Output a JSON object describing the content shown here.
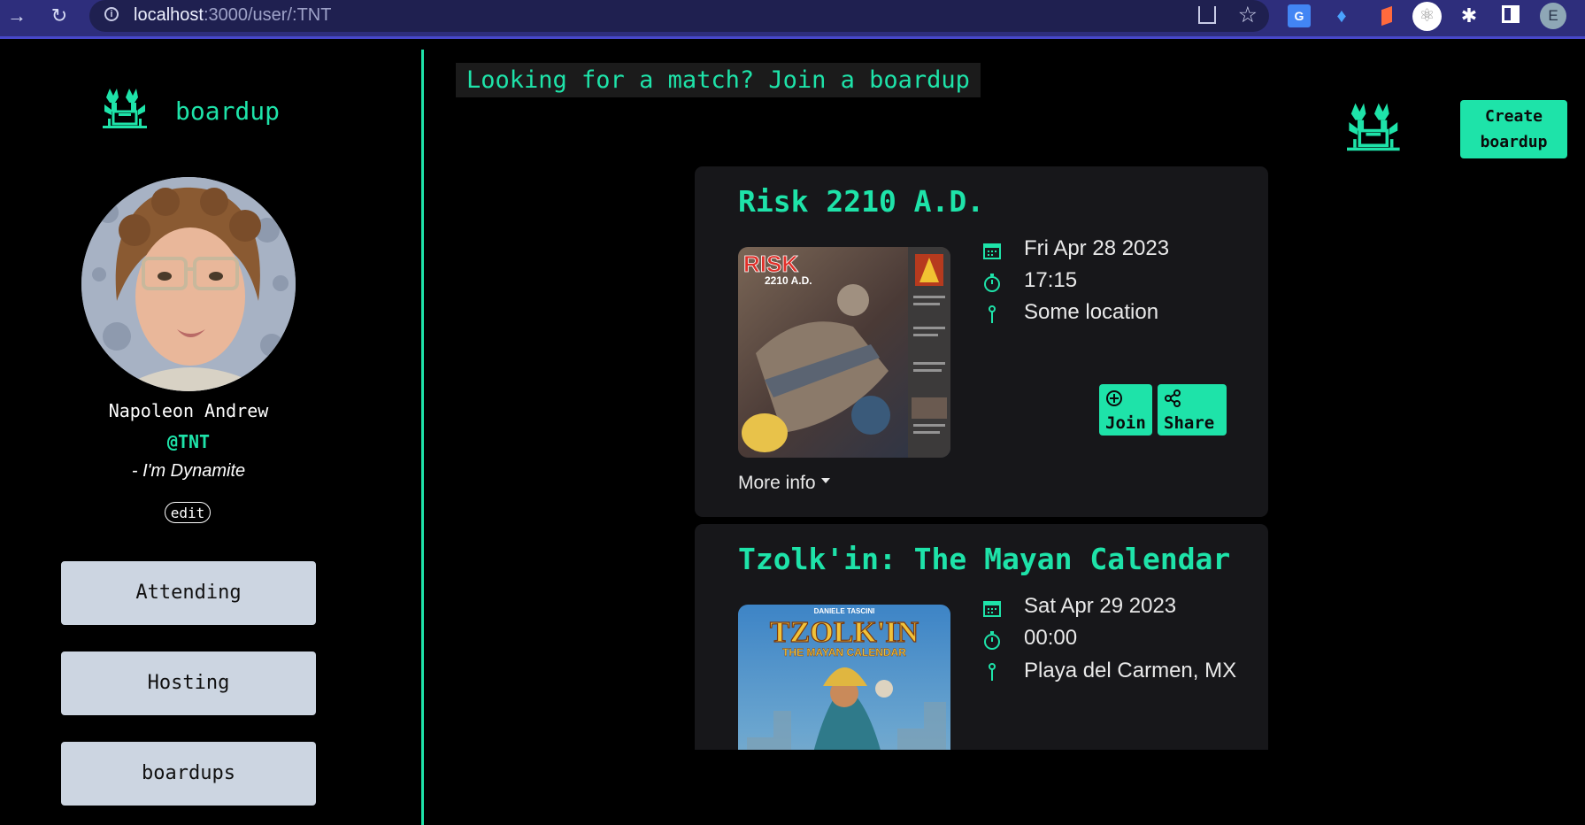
{
  "browser": {
    "url_host": "localhost",
    "url_path": ":3000/user/:TNT",
    "profile_initial": "E",
    "translate_label": "G"
  },
  "sidebar": {
    "brand": "boardup",
    "user": {
      "name": "Napoleon Andrew",
      "handle": "@TNT",
      "bio": "- I'm Dynamite",
      "edit_label": "edit"
    },
    "nav": [
      {
        "label": "Attending"
      },
      {
        "label": "Hosting"
      },
      {
        "label": "boardups"
      }
    ]
  },
  "main": {
    "cta": "Looking for a match? Join a boardup",
    "create_button": "Create boardup",
    "create_line1": "Create",
    "create_line2": "boardup",
    "events": [
      {
        "title": "Risk 2210 A.D.",
        "cover_title": "RISK",
        "cover_subtitle": "2210 A.D.",
        "date": "Fri Apr 28 2023",
        "time": "17:15",
        "location": "Some location",
        "join_label": "Join",
        "share_label": "Share",
        "more_info": "More info"
      },
      {
        "title": "Tzolk'in: The Mayan Calendar",
        "cover_title": "TZOLK'IN",
        "cover_subtitle": "THE MAYAN CALENDAR",
        "cover_author": "DANIELE TASCINI",
        "date": "Sat Apr 29 2023",
        "time": "00:00",
        "location": "Playa del Carmen, MX"
      }
    ]
  },
  "colors": {
    "accent": "#1ee3a9",
    "background": "#000000",
    "card": "#17171a",
    "sidebar_button": "#ccd5e1",
    "browser_chrome": "#2e2e7c"
  },
  "icons": [
    "arrow-right-icon",
    "reload-icon",
    "info-icon",
    "share-page-icon",
    "star-icon",
    "translate-icon",
    "gem-icon",
    "flag-icon",
    "react-icon",
    "puzzle-icon",
    "side-panel-icon",
    "boardup-logo",
    "calendar-icon",
    "stopwatch-icon",
    "pin-icon",
    "plus-circle-icon",
    "share-icon"
  ]
}
